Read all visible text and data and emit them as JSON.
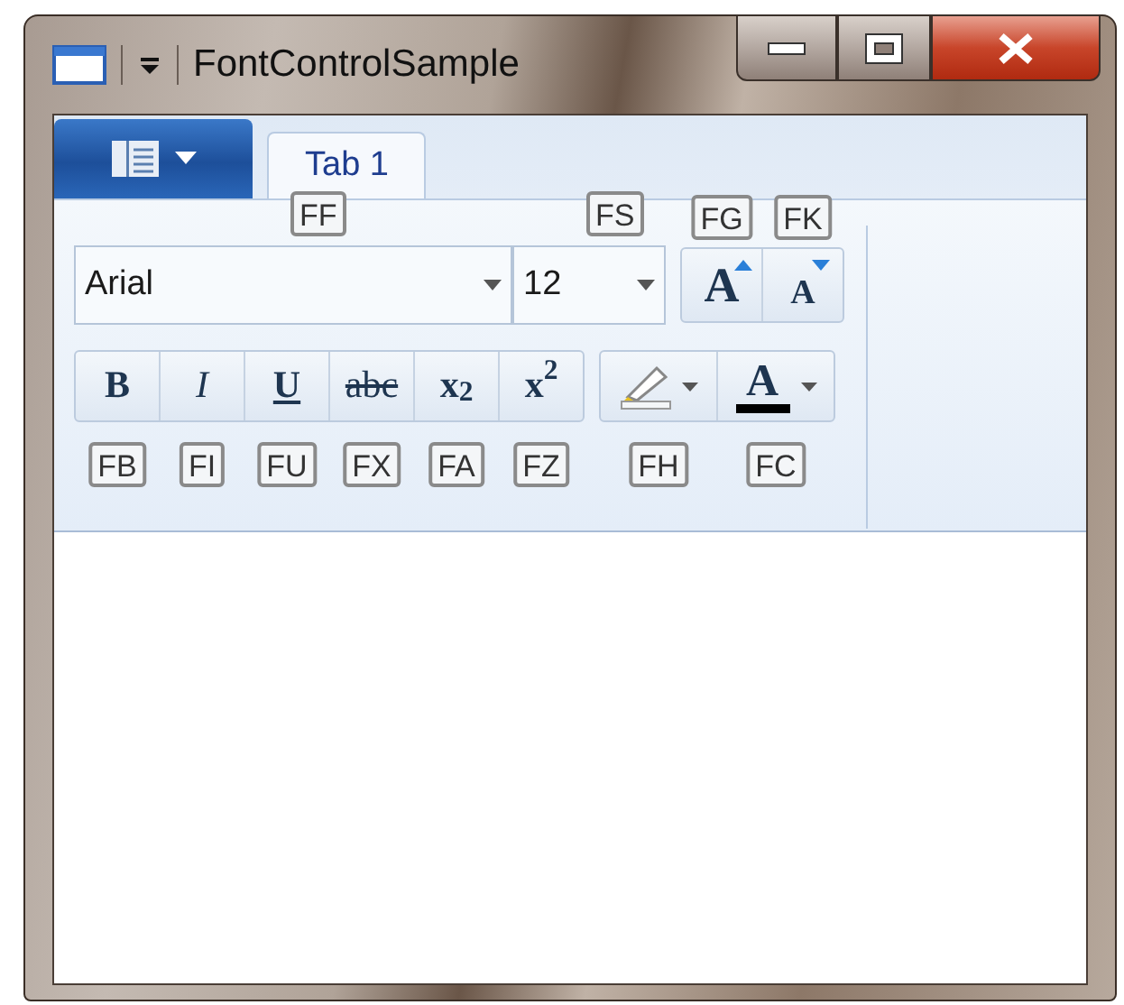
{
  "window": {
    "title": "FontControlSample"
  },
  "tabs": [
    {
      "label": "Tab 1",
      "selected": true
    }
  ],
  "font_family": {
    "value": "Arial",
    "key_tip": "FF"
  },
  "font_size": {
    "value": "12",
    "key_tip": "FS"
  },
  "size_buttons": [
    {
      "kind": "grow",
      "label": "A",
      "key_tip": "FG"
    },
    {
      "kind": "shrink",
      "label": "A",
      "key_tip": "FK"
    }
  ],
  "format_buttons": [
    {
      "kind": "bold",
      "label": "B",
      "key_tip": "FB"
    },
    {
      "kind": "italic",
      "label": "I",
      "key_tip": "FI"
    },
    {
      "kind": "underline",
      "label": "U",
      "key_tip": "FU"
    },
    {
      "kind": "strikethrough",
      "label": "abc",
      "key_tip": "FX"
    },
    {
      "kind": "subscript",
      "label": "x$_{2}$",
      "key_tip": "FA"
    },
    {
      "kind": "superscript",
      "label": "x$^{2}$",
      "key_tip": "FZ"
    }
  ],
  "color_buttons": [
    {
      "kind": "highlight",
      "key_tip": "FH",
      "color": "#f4f6f8"
    },
    {
      "kind": "font_color",
      "label": "A",
      "key_tip": "FC",
      "color": "#000000"
    }
  ]
}
